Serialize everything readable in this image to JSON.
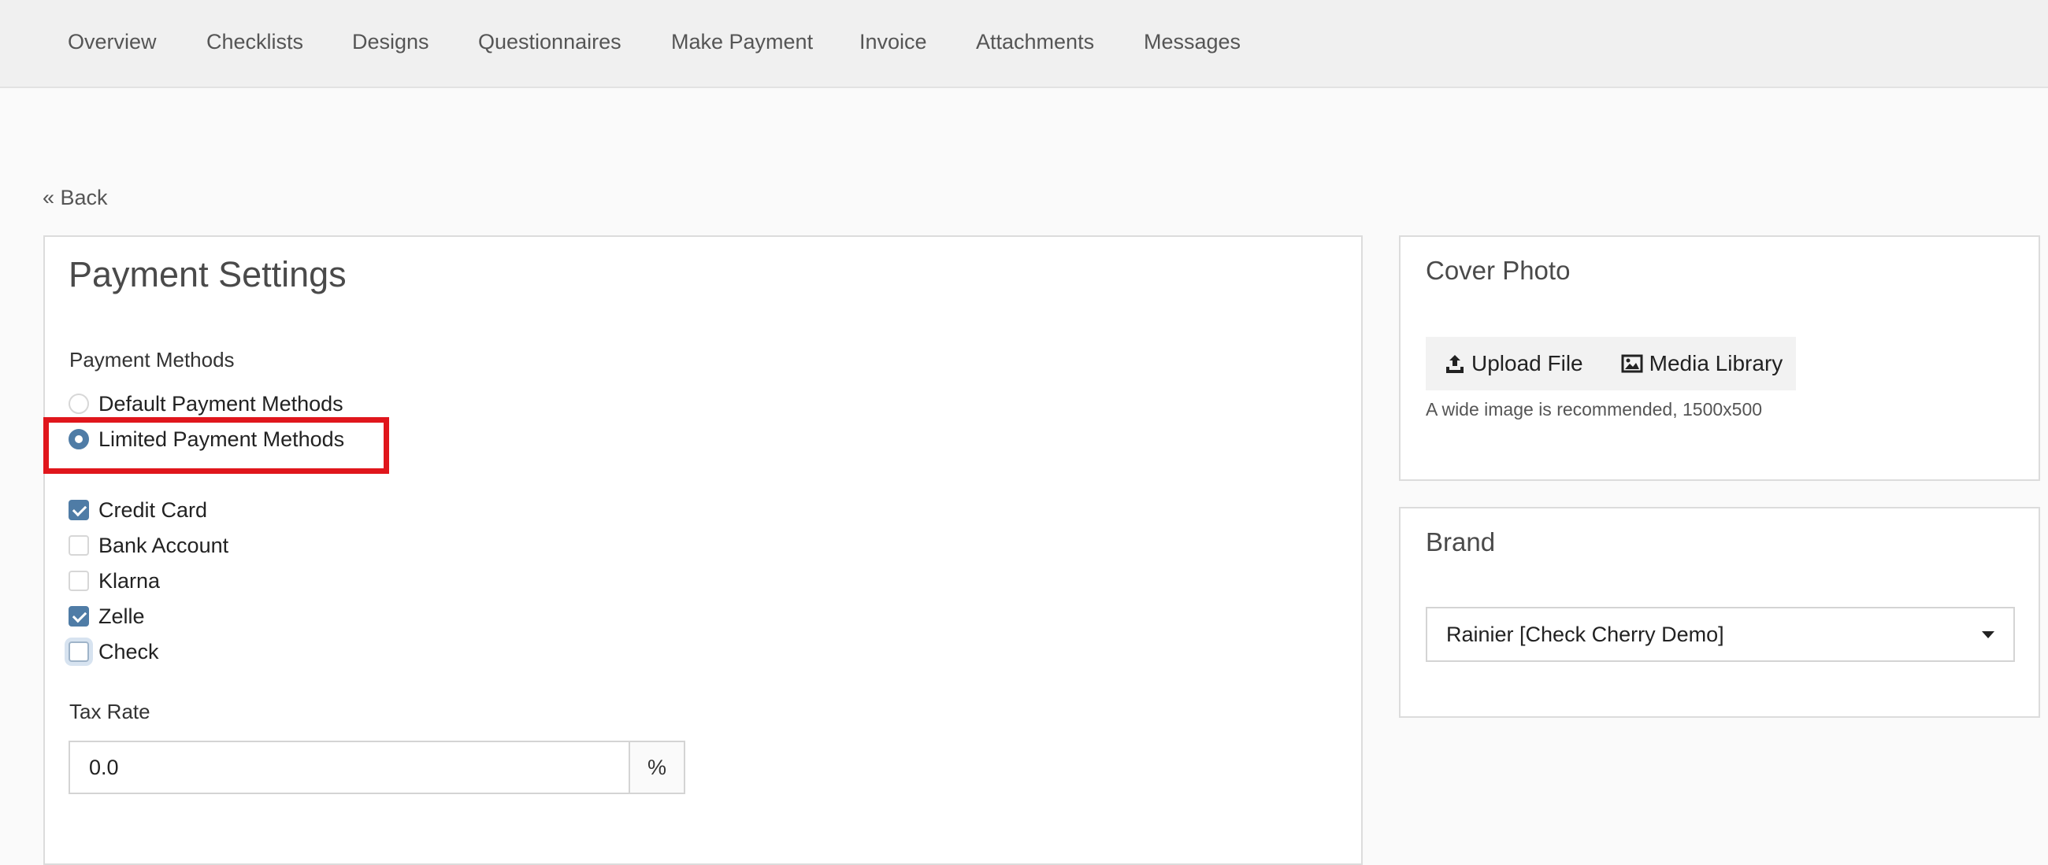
{
  "nav": {
    "items": [
      {
        "label": "Overview"
      },
      {
        "label": "Checklists"
      },
      {
        "label": "Designs"
      },
      {
        "label": "Questionnaires"
      },
      {
        "label": "Make Payment"
      },
      {
        "label": "Invoice"
      },
      {
        "label": "Attachments"
      },
      {
        "label": "Messages"
      }
    ]
  },
  "back_link": "« Back",
  "payment_settings": {
    "title": "Payment Settings",
    "methods_label": "Payment Methods",
    "method_options": [
      {
        "label": "Default Payment Methods",
        "selected": false
      },
      {
        "label": "Limited Payment Methods",
        "selected": true
      }
    ],
    "limited_methods": [
      {
        "label": "Credit Card",
        "checked": true
      },
      {
        "label": "Bank Account",
        "checked": false
      },
      {
        "label": "Klarna",
        "checked": false
      },
      {
        "label": "Zelle",
        "checked": true
      },
      {
        "label": "Check",
        "checked": false
      }
    ],
    "tax_rate_label": "Tax Rate",
    "tax_rate_value": "0.0",
    "tax_rate_unit": "%"
  },
  "cover_photo": {
    "title": "Cover Photo",
    "upload_label": "Upload File",
    "media_library_label": "Media Library",
    "helper": "A wide image is recommended, 1500x500"
  },
  "brand": {
    "title": "Brand",
    "selected": "Rainier [Check Cherry Demo]"
  },
  "colors": {
    "accent": "#4f7ca6",
    "highlight": "#e0161c"
  }
}
